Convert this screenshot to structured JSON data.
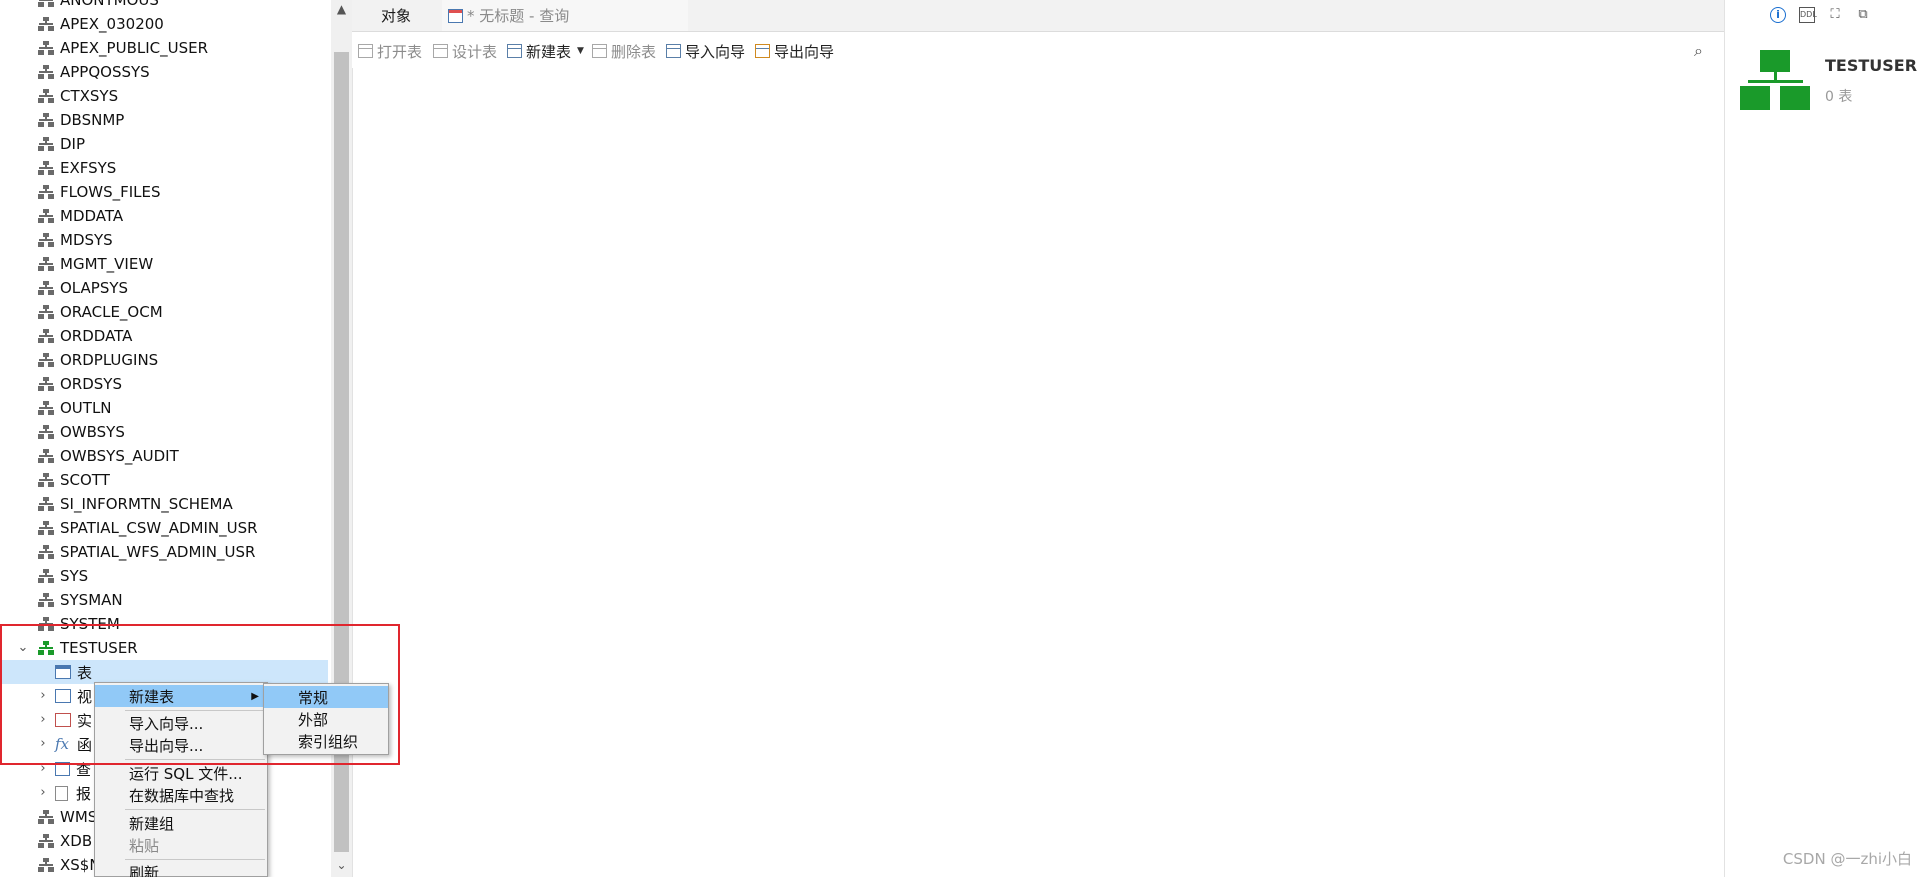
{
  "tree": {
    "schemas": [
      "ANONYMOUS",
      "APEX_030200",
      "APEX_PUBLIC_USER",
      "APPQOSSYS",
      "CTXSYS",
      "DBSNMP",
      "DIP",
      "EXFSYS",
      "FLOWS_FILES",
      "MDDATA",
      "MDSYS",
      "MGMT_VIEW",
      "OLAPSYS",
      "ORACLE_OCM",
      "ORDDATA",
      "ORDPLUGINS",
      "ORDSYS",
      "OUTLN",
      "OWBSYS",
      "OWBSYS_AUDIT",
      "SCOTT",
      "SI_INFORMTN_SCHEMA",
      "SPATIAL_CSW_ADMIN_USR",
      "SPATIAL_WFS_ADMIN_USR",
      "SYS",
      "SYSMAN",
      "SYSTEM"
    ],
    "active_schema": "TESTUSER",
    "children": [
      "表",
      "视",
      "实",
      "函",
      "查",
      "报"
    ],
    "after": [
      "WMS",
      "XDB",
      "XS$N"
    ]
  },
  "tabs": {
    "objects": "对象",
    "query": "* 无标题 - 查询"
  },
  "toolbar": {
    "open_table": "打开表",
    "design_table": "设计表",
    "new_table": "新建表",
    "delete_table": "删除表",
    "import_wizard": "导入向导",
    "export_wizard": "导出向导",
    "search_icon": "⌕"
  },
  "right_panel": {
    "name": "TESTUSER",
    "count": "0 表"
  },
  "context_menu": {
    "items": [
      "新建表",
      "导入向导...",
      "导出向导...",
      "运行 SQL 文件...",
      "在数据库中查找",
      "新建组",
      "粘贴",
      "刷新"
    ]
  },
  "submenu": {
    "items": [
      "常规",
      "外部",
      "索引组织"
    ]
  },
  "watermark": "CSDN @一zhi小白",
  "colors": {
    "highlight_border": "#e0262e",
    "menu_highlight": "#91c9f7",
    "schema_green": "#1a9a2a"
  }
}
